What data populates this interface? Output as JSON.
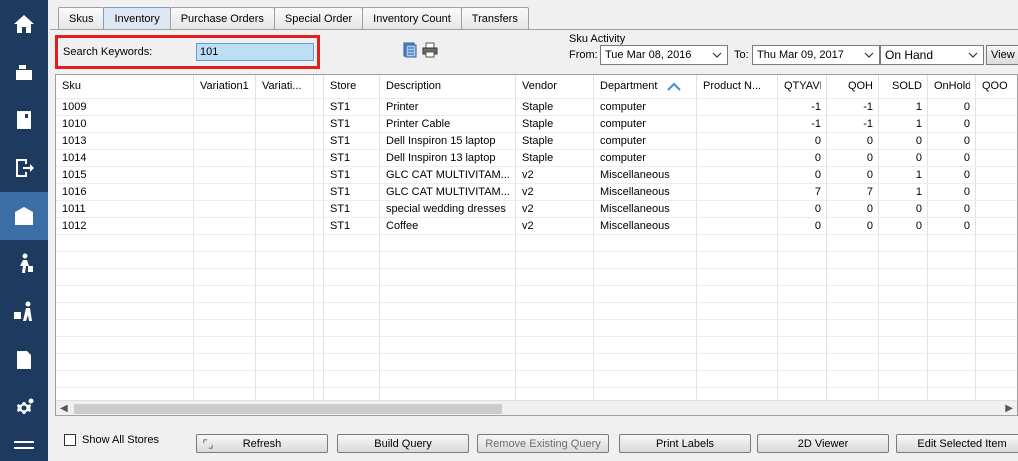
{
  "tabs": [
    "Skus",
    "Inventory",
    "Purchase Orders",
    "Special Order",
    "Inventory Count",
    "Transfers"
  ],
  "active_tab": "Inventory",
  "search": {
    "label": "Search Keywords:",
    "value": "101"
  },
  "sku_activity": {
    "label": "Sku Activity",
    "from_label": "From:",
    "from_value": "Tue  Mar 08, 2016",
    "to_label": "To:",
    "to_value": "Thu  Mar 09, 2017",
    "mode": "On Hand",
    "view_label": "View"
  },
  "columns": [
    "Sku",
    "Variation1",
    "Variati...",
    "",
    "Store",
    "Description",
    "Vendor",
    "Department",
    "Product N...",
    "QTYAVL",
    "QOH",
    "SOLD",
    "OnHold",
    "QOO"
  ],
  "sort_column": "Department",
  "rows": [
    [
      "1009",
      "",
      "",
      "",
      "ST1",
      "Printer",
      "Staple",
      "computer",
      "",
      "-1",
      "-1",
      "1",
      "0"
    ],
    [
      "1010",
      "",
      "",
      "",
      "ST1",
      "Printer Cable",
      "Staple",
      "computer",
      "",
      "-1",
      "-1",
      "1",
      "0"
    ],
    [
      "1013",
      "",
      "",
      "",
      "ST1",
      "Dell Inspiron 15 laptop",
      "Staple",
      "computer",
      "",
      "0",
      "0",
      "0",
      "0"
    ],
    [
      "1014",
      "",
      "",
      "",
      "ST1",
      "Dell Inspiron 13 laptop",
      "Staple",
      "computer",
      "",
      "0",
      "0",
      "0",
      "0"
    ],
    [
      "1015",
      "",
      "",
      "",
      "ST1",
      "GLC CAT MULTIVITAM...",
      "v2",
      "Miscellaneous",
      "",
      "0",
      "0",
      "1",
      "0"
    ],
    [
      "1016",
      "",
      "",
      "",
      "ST1",
      "GLC CAT MULTIVITAM...",
      "v2",
      "Miscellaneous",
      "",
      "7",
      "7",
      "1",
      "0"
    ],
    [
      "1011",
      "",
      "",
      "",
      "ST1",
      "special wedding dresses",
      "v2",
      "Miscellaneous",
      "",
      "0",
      "0",
      "0",
      "0"
    ],
    [
      "1012",
      "",
      "",
      "",
      "ST1",
      "Coffee",
      "v2",
      "Miscellaneous",
      "",
      "0",
      "0",
      "0",
      "0"
    ]
  ],
  "show_all_stores": {
    "label": "Show All Stores",
    "checked": false
  },
  "buttons": {
    "refresh": "Refresh",
    "build_query": "Build Query",
    "remove_query": "Remove Existing Query",
    "print_labels": "Print Labels",
    "viewer_2d": "2D Viewer",
    "edit_item": "Edit Selected Item"
  },
  "nav_icons": [
    "home-icon",
    "cash-register-icon",
    "receipt-icon",
    "sign-out-icon",
    "inventory-grid-icon",
    "customer-icon",
    "delivery-icon",
    "report-icon",
    "settings-icon",
    "menu-icon"
  ],
  "colors": {
    "sidebar": "#1e3a5f",
    "sidebar_active": "#3a6ea5",
    "highlight": "#e02020",
    "search_bg": "#bcdff5"
  }
}
